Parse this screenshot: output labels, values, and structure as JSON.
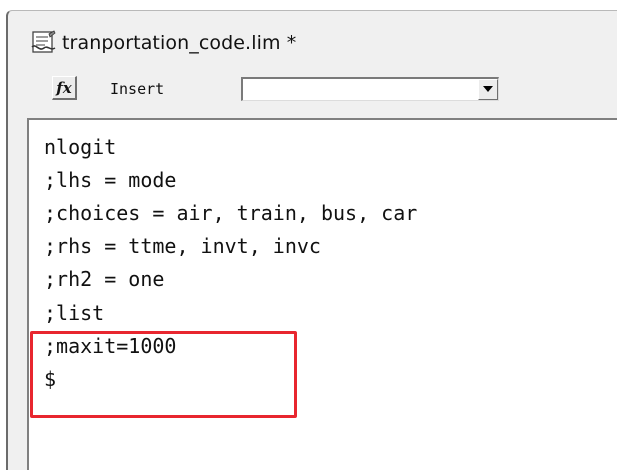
{
  "window": {
    "title": "tranportation_code.lim *",
    "title_icon": "script-file-icon"
  },
  "toolbar": {
    "fx_label": "fx",
    "insert_label": "Insert",
    "insert_dropdown_value": ""
  },
  "editor": {
    "lines": [
      "nlogit",
      ";lhs = mode",
      ";choices = air, train, bus, car",
      ";rhs = ttme, invt, invc",
      ";rh2 = one",
      ";list",
      ";maxit=1000",
      "$"
    ]
  },
  "colors": {
    "highlight_border": "#e8262f",
    "window_background": "#f0f0f0",
    "editor_background": "#ffffff"
  }
}
